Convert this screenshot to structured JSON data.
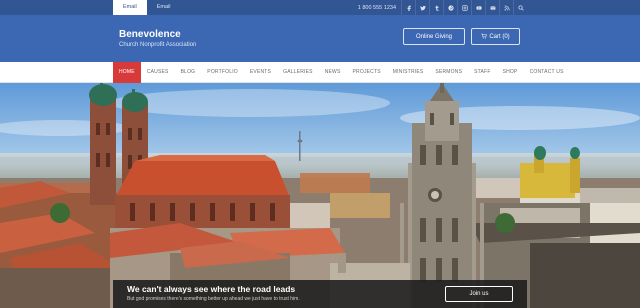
{
  "topbar": {
    "links": [
      {
        "label": "Email",
        "active": true
      },
      {
        "label": "Email",
        "active": false
      }
    ],
    "phone": "1 800 555 1234",
    "social_icons": [
      "facebook-icon",
      "twitter-icon",
      "tumblr-icon",
      "pinterest-icon",
      "instagram-icon",
      "youtube-icon",
      "email-icon",
      "rss-icon",
      "search-icon"
    ]
  },
  "header": {
    "site_title": "Benevolence",
    "tagline": "Church Nonprofit Association",
    "donate_label": "Online Giving",
    "cart_label": "Cart (0)"
  },
  "nav": {
    "items": [
      "Home",
      "Causes",
      "Blog",
      "Portfolio",
      "Events",
      "Galleries",
      "News",
      "Projects",
      "Ministries",
      "Sermons",
      "Staff",
      "Shop",
      "Contact Us"
    ]
  },
  "hero": {
    "caption_title": "We can't always see where the road leads",
    "caption_text": "But god promises there's something better up ahead we just have to trust him.",
    "button_label": "Join us"
  },
  "colors": {
    "topbar": "#325593",
    "header": "#3b67b3",
    "nav_active": "#d83a3a"
  }
}
